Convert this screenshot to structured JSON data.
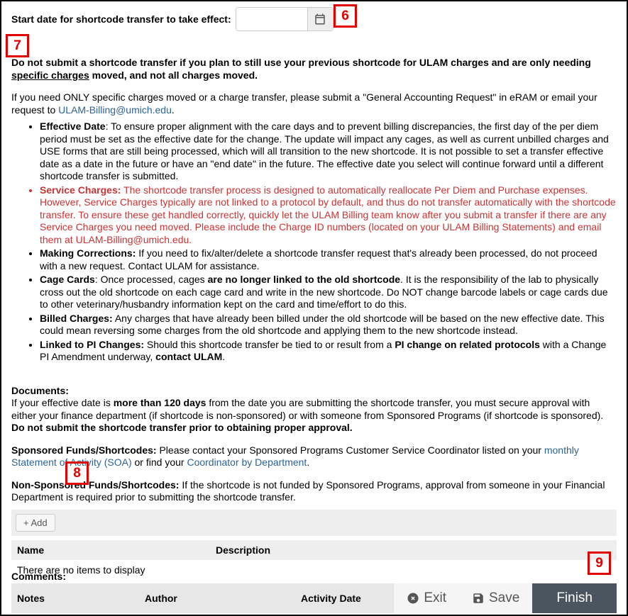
{
  "startdate": {
    "label": "Start date for shortcode transfer to take effect:",
    "value": ""
  },
  "callouts": {
    "c6": "6",
    "c7": "7",
    "c8": "8",
    "c9": "9"
  },
  "warn": {
    "pre": "Do not submit a shortcode transfer if you plan to still use your previous shortcode for ULAM charges and are only needing ",
    "underlined": "specific charges",
    "post": " moved, and not all charges moved."
  },
  "intro": {
    "p1a": "If you need ONLY specific charges moved or a charge transfer, please submit a \"General Accounting Request\" in eRAM or email your request to ",
    "email": "ULAM-Billing@umich.edu",
    "p1b": "."
  },
  "bullets": {
    "b1_label": "Effective Date",
    "b1_text": ": To ensure proper alignment with the care days and to prevent billing discrepancies, the first day of the per diem period must be set as the effective date for the change. The update will impact any cages, as well as current unbilled charges and USE forms that are still being processed, which will all transition to the new shortcode. It is not possible to set a transfer effective date as a date in the future or have an \"end date\" in the future. The effective date you select will continue forward until a different shortcode transfer is submitted.",
    "b2_label": "Service Charges:",
    "b2_text": " The shortcode transfer process is designed to automatically reallocate Per Diem and Purchase expenses. However, Service Charges typically are not linked to a protocol by default, and thus do not transfer automatically with the shortcode transfer. To ensure these get handled correctly, quickly let the ULAM Billing team know after you submit a transfer if there are any Service Charges you need moved. Please include the Charge ID numbers (located on your ULAM Billing Statements) and email them at ULAM-Billing@umich.edu.",
    "b3_label": "Making Corrections:",
    "b3_text": " If you need to fix/alter/delete a shortcode transfer request that's already been processed, do not proceed with a new request. Contact ULAM for assistance.",
    "b4_label": "Cage Cards",
    "b4_text_a": ": Once processed, cages ",
    "b4_bold": "are no longer linked to the old shortcode",
    "b4_text_b": ". It is the responsibility of the lab to physically cross out the old shortcode on each cage card and write in the new shortcode. Do NOT change barcode labels or cage cards due to other veterinary/husbandry information kept on the card and time/effort to do this.",
    "b5_label": "Billed Charges:",
    "b5_text": " Any charges that have already been billed under the old shortcode will be based on the new effective date. This could mean reversing some charges from the old shortcode and applying them to the new shortcode instead.",
    "b6_label": "Linked to PI Changes:",
    "b6_text_a": " Should this shortcode transfer be tied to or result from a ",
    "b6_bold": "PI change on related protocols",
    "b6_text_b": " with a Change PI Amendment underway, ",
    "b6_bold2": "contact ULAM"
  },
  "docs": {
    "heading": "Documents:",
    "p1a": "If your effective date is ",
    "p1bold": "more than 120 days",
    "p1b": " from the date you are submitting the shortcode transfer, you must secure approval with either your finance department (if shortcode is non-sponsored) or with someone from Sponsored Programs (if shortcode is sponsored). ",
    "p1bold2": "Do not submit the shortcode transfer prior to obtaining proper approval.",
    "sp_label": "Sponsored Funds/Shortcodes:",
    "sp_text_a": " Please contact your Sponsored Programs Customer Service Coordinator listed on your ",
    "sp_link1": "monthly Statement of Activity (SOA)",
    "sp_text_b": " or find your ",
    "sp_link2": "Coordinator by Department",
    "sp_text_c": ".",
    "nsp_label": "Non-Sponsored Funds/Shortcodes:",
    "nsp_text": " If the shortcode is not funded by Sponsored Programs, approval from someone in your Financial Department is required prior to submitting the shortcode transfer."
  },
  "addbtn": "+ Add",
  "table": {
    "col_name": "Name",
    "col_desc": "Description",
    "empty": "There are no items to display"
  },
  "comments_label": "Comments:",
  "notesbar": {
    "notes": "Notes",
    "author": "Author",
    "date": "Activity Date"
  },
  "actions": {
    "exit": "Exit",
    "save": "Save",
    "finish": "Finish"
  }
}
